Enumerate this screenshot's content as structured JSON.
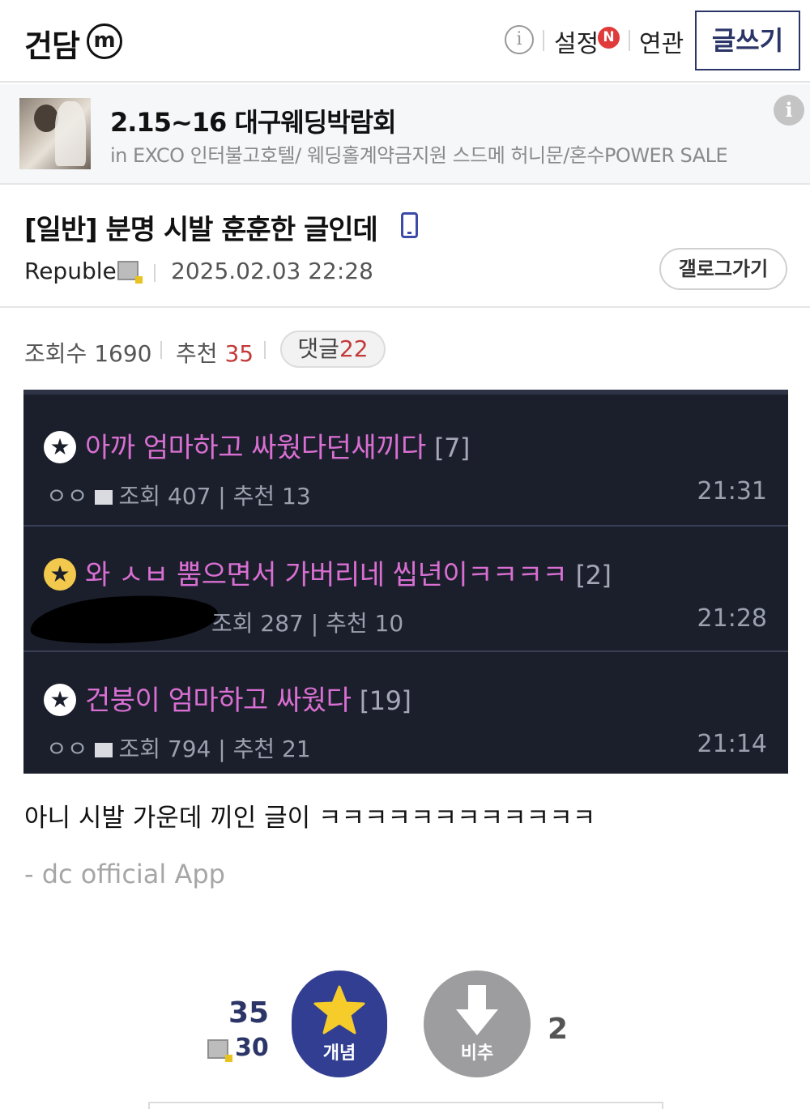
{
  "header": {
    "gallery_name": "건담",
    "gallery_badge": "m",
    "info_glyph": "i",
    "settings_label": "설정",
    "new_badge": "N",
    "related_label": "연관",
    "write_label": "글쓰기"
  },
  "ad": {
    "title": "2.15~16 대구웨딩박람회",
    "subtitle": "in EXCO 인터불고호텔/ 웨딩홀계약금지원 스드메 허니문/혼수POWER SALE",
    "info_glyph": "i"
  },
  "post": {
    "title": "[일반] 분명 시발 훈훈한 글인데",
    "author": "Republe",
    "date": "2025.02.03 22:28",
    "gallery_button": "갤로그가기",
    "views_label": "조회수",
    "views": "1690",
    "recommend_label": "추천",
    "recommend": "35",
    "comments_label": "댓글",
    "comments": "22",
    "body": "아니 시발 가운데 끼인 글이 ㅋㅋㅋㅋㅋㅋㅋㅋㅋㅋㅋㅋ",
    "signature": "- dc official App"
  },
  "embedded": {
    "rows": [
      {
        "title": "아까 엄마하고 싸웠다던새끼다",
        "count": "[7]",
        "author": "ㅇㅇ",
        "meta": "조회 407 | 추천 13",
        "time": "21:31"
      },
      {
        "title": "와 ㅅㅂ 뿜으면서 가버리네 씹년이ㅋㅋㅋㅋ",
        "count": "[2]",
        "author": "",
        "meta": "조회 287 | 추천 10",
        "time": "21:28"
      },
      {
        "title": "건붕이 엄마하고 싸웠다",
        "count": "[19]",
        "author": "ㅇㅇ",
        "meta": "조회 794 | 추천 21",
        "time": "21:14"
      }
    ]
  },
  "votes": {
    "up_count": "35",
    "fixed_count": "30",
    "up_label": "개념",
    "down_label": "비추",
    "down_count": "2"
  },
  "colors": {
    "brand": "#2b3567",
    "vote_up": "#323e91",
    "vote_down": "#9d9da0",
    "accent_red": "#c33a3a",
    "embedded_bg": "#1b1f2b",
    "embedded_title": "#d96fd3"
  },
  "icons": [
    "m-badge-icon",
    "info-icon",
    "new-badge-icon",
    "phone-icon",
    "member-icon",
    "star-icon",
    "down-arrow-icon"
  ]
}
